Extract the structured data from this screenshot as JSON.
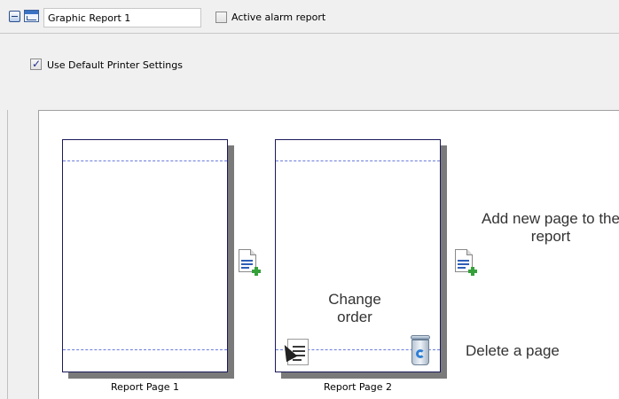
{
  "toolbar": {
    "report_name": "Graphic Report 1",
    "active_alarm_label": "Active alarm report",
    "active_alarm_checked": false
  },
  "settings": {
    "use_default_printer_label": "Use Default Printer Settings",
    "use_default_printer_checked": true
  },
  "pages": [
    {
      "caption": "Report Page 1"
    },
    {
      "caption": "Report Page 2"
    }
  ],
  "hints": {
    "add_page": "Add new page to the report",
    "change_order": "Change order",
    "delete_page": "Delete a page"
  },
  "icons": {
    "collapse": "collapse-icon",
    "report_type": "graphic-report-icon",
    "add_page": "add-page-icon",
    "reorder": "drag-page-icon",
    "delete": "recycle-bin-icon"
  },
  "colors": {
    "page_border": "#1a1a5a",
    "margin_line": "#6b7ddd",
    "page_shadow": "#7a7a7a",
    "add_plus": "#36a13b"
  }
}
